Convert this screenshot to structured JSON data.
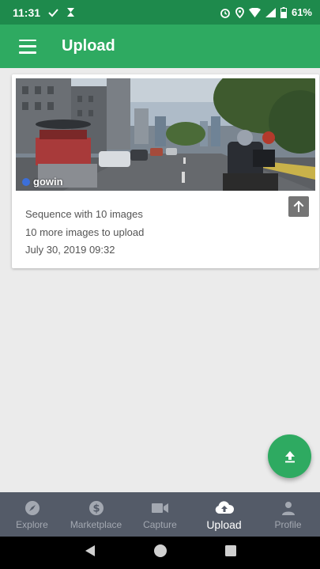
{
  "status_bar": {
    "time": "11:31",
    "battery": "61%"
  },
  "app_bar": {
    "title": "Upload"
  },
  "sequence_card": {
    "username": "gowin",
    "line1": "Sequence with 10 images",
    "line2": "10 more images to upload",
    "line3": "July 30, 2019 09:32"
  },
  "bottom_nav": {
    "items": [
      {
        "label": "Explore",
        "icon": "compass-icon",
        "active": false
      },
      {
        "label": "Marketplace",
        "icon": "dollar-icon",
        "active": false
      },
      {
        "label": "Capture",
        "icon": "video-camera-icon",
        "active": false
      },
      {
        "label": "Upload",
        "icon": "cloud-upload-icon",
        "active": true
      },
      {
        "label": "Profile",
        "icon": "person-icon",
        "active": false
      }
    ]
  },
  "colors": {
    "status_bar": "#1e8a4c",
    "app_bar": "#2eaa61",
    "fab": "#2eaa61",
    "bottom_nav": "#545b68",
    "nav_inactive": "#a3a8b1",
    "nav_active": "#ffffff"
  }
}
